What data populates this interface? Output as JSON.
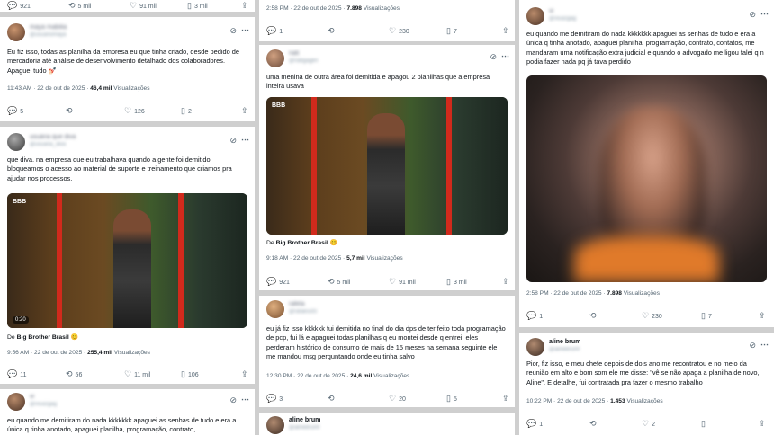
{
  "col1": {
    "top_stats": {
      "replies": "921",
      "reposts": "5 mil",
      "likes": "91 mil",
      "views": "3 mil"
    },
    "post1": {
      "name": "maya mabilia",
      "handle": "@usuariomaya",
      "text": "Eu fiz isso, todas as planilha da empresa eu que tinha criado, desde pedido de mercadoria até análise de desenvolvimento detalhado dos colaboradores. Apaguei tudo 💅🏻",
      "time": "11:43 AM · 22 de out de 2025 · ",
      "views_count": "46,4 mil",
      "views_label": " Visualizações",
      "replies": "5",
      "reposts": "",
      "likes": "126",
      "bookmarks": "2"
    },
    "post2": {
      "name": "usuária que diva",
      "handle": "@usuaria_diva",
      "text": "que diva. na empresa que eu trabalhava quando a gente foi demitido bloqueamos o acesso ao material de suporte e treinamento que criamos pra ajudar nos processos.",
      "video_logo": "BBB",
      "video_duration": "0:20",
      "source_prefix": "De ",
      "source_name": "Big Brother Brasil",
      "time": "9:56 AM · 22 de out de 2025 · ",
      "views_count": "255,4 mil",
      "views_label": " Visualizações",
      "replies": "11",
      "reposts": "56",
      "likes": "11 mil",
      "bookmarks": "106"
    },
    "post3": {
      "name": "vi",
      "handle": "@viuazgag",
      "text": "eu quando me demitiram do nada kkkkkkk apaguei as senhas de tudo e era a única q tinha anotado, apaguei planilha, programação, contrato,"
    }
  },
  "col2": {
    "top": {
      "time": "2:58 PM · 22 de out de 2025 · ",
      "views_count": "7.898",
      "views_label": " Visualizações",
      "replies": "1",
      "reposts": "",
      "likes": "230",
      "bookmarks": "7"
    },
    "post1": {
      "name": "nati",
      "handle": "@natigagen",
      "text": "uma menina de outra área foi demitida e apagou 2 planilhas que a empresa inteira usava",
      "video_logo": "BBB",
      "source_prefix": "De ",
      "source_name": "Big Brother Brasil",
      "time": "9:18 AM · 22 de out de 2025 · ",
      "views_count": "5,7 mil",
      "views_label": " Visualizações",
      "replies": "921",
      "reposts": "5 mil",
      "likes": "91 mil",
      "views": "3 mil"
    },
    "post2": {
      "name": "rafela",
      "handle": "@rafaesof3",
      "text": "eu já fiz isso kkkkkk fui demitida no final do dia dps de ter feito toda programação de pcp, fui lá e apaguei todas planilhas q eu montei desde q entrei, eles perderam histórico de consumo de mais de 15 meses na semana seguinte ele me mandou msg perguntando onde eu tinha salvo",
      "time": "12:30 PM · 22 de out de 2025 · ",
      "views_count": "24,6 mil",
      "views_label": " Visualizações",
      "replies": "3",
      "reposts": "",
      "likes": "20",
      "bookmarks": "5"
    },
    "post3": {
      "name": "aline brum",
      "handle": "@alinebrumf"
    }
  },
  "col3": {
    "post1": {
      "name": "vi",
      "handle": "@viuazgag",
      "text": "eu quando me demitiram do nada kkkkkkk apaguei as senhas de tudo e era a única q tinha anotado, apaguei planilha, programação, contrato, contatos, me mandaram uma notificação extra judicial e quando o advogado me ligou falei q n podia fazer nada pq já tava perdido",
      "time": "2:58 PM · 22 de out de 2025 · ",
      "views_count": "7.898",
      "views_label": " Visualizações",
      "replies": "1",
      "reposts": "",
      "likes": "230",
      "bookmarks": "7"
    },
    "post2": {
      "name": "aline brum",
      "handle": "@alinebrumf",
      "text": "Pior, fiz isso, e meu chefe depois de dois ano me recontratou e no meio da reunião em alto e bom som ele me disse: \"vê se não apaga a planilha de novo, Aline\". E detalhe, fui contratada pra fazer o mesmo trabalho",
      "time": "10:22 PM · 22 de out de 2025 · ",
      "views_count": "1.453",
      "views_label": " Visualizações",
      "replies": "1",
      "reposts": "",
      "likes": "2",
      "bookmarks": ""
    }
  },
  "icons": {
    "reply": "reply-icon",
    "repost": "repost-icon",
    "like": "heart-icon",
    "bookmark": "bookmark-icon",
    "share": "share-icon",
    "grok": "grok-icon",
    "more": "more-icon"
  },
  "colors": {
    "background": "#cfcfcf",
    "card": "#ffffff",
    "muted": "#536471",
    "text": "#0f1419",
    "bbb_red": "#d12a1c"
  }
}
